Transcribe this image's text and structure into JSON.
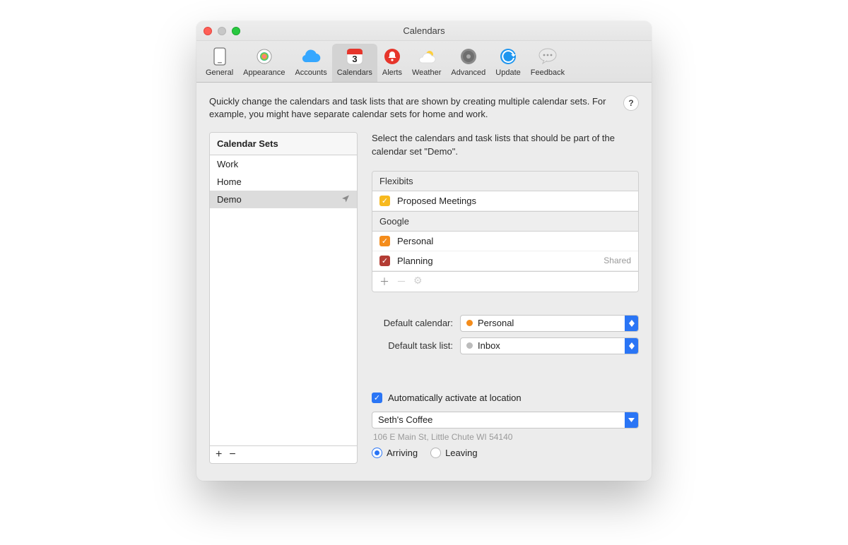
{
  "window": {
    "title": "Calendars"
  },
  "toolbar": {
    "items": [
      {
        "label": "General",
        "icon": "📱"
      },
      {
        "label": "Appearance",
        "icon": "🎨"
      },
      {
        "label": "Accounts",
        "icon": "☁️"
      },
      {
        "label": "Calendars",
        "icon": "📅"
      },
      {
        "label": "Alerts",
        "icon": "🔔"
      },
      {
        "label": "Weather",
        "icon": "⛅"
      },
      {
        "label": "Advanced",
        "icon": "⚙️"
      },
      {
        "label": "Update",
        "icon": "🔄"
      },
      {
        "label": "Feedback",
        "icon": "💬"
      }
    ],
    "selected_index": 3,
    "calendar_day": "3"
  },
  "intro": "Quickly change the calendars and task lists that are shown by creating multiple calendar sets. For example, you might have separate calendar sets for home and work.",
  "help_mark": "?",
  "sets": {
    "header": "Calendar Sets",
    "items": [
      "Work",
      "Home",
      "Demo"
    ],
    "selected_index": 2,
    "add": "+",
    "remove": "−"
  },
  "right": {
    "select_text": "Select the calendars and task lists that should be part of the calendar set \"Demo\".",
    "groups": [
      {
        "name": "Flexibits",
        "calendars": [
          {
            "name": "Proposed Meetings",
            "color": "#f7b91e",
            "checked": true
          }
        ]
      },
      {
        "name": "Google",
        "calendars": [
          {
            "name": "Personal",
            "color": "#f48c1b",
            "checked": true
          },
          {
            "name": "Planning",
            "color": "#b33c34",
            "checked": true,
            "shared": "Shared"
          }
        ]
      }
    ],
    "list_actions": {
      "add": "＋",
      "remove": "－",
      "gear": "⚙"
    }
  },
  "defaults": {
    "cal_label": "Default calendar:",
    "cal_value": "Personal",
    "cal_color": "#f48c1b",
    "task_label": "Default task list:",
    "task_value": "Inbox",
    "task_color": "#bcbcbc"
  },
  "location": {
    "auto_label": "Automatically activate at location",
    "auto_checked": true,
    "place": "Seth's Coffee",
    "address": "106 E Main St, Little Chute WI 54140",
    "arriving": "Arriving",
    "leaving": "Leaving",
    "selected": "arriving"
  }
}
